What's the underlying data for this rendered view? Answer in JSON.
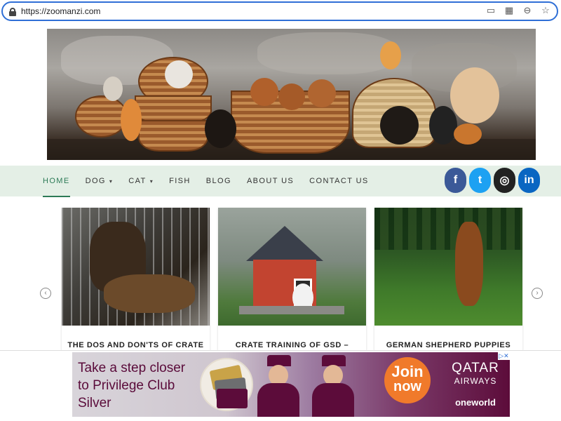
{
  "browser": {
    "url": "https://zoomanzi.com",
    "icons": [
      "cast-icon",
      "qr-code-icon",
      "zoom-icon",
      "bookmark-star-icon"
    ]
  },
  "nav": {
    "items": [
      {
        "label": "HOME",
        "active": true
      },
      {
        "label": "DOG",
        "dropdown": true
      },
      {
        "label": "CAT",
        "dropdown": true
      },
      {
        "label": "FISH"
      },
      {
        "label": "BLOG"
      },
      {
        "label": "ABOUT US"
      },
      {
        "label": "CONTACT US"
      }
    ],
    "social": [
      {
        "name": "facebook",
        "glyph": "f",
        "color": "#3b5998"
      },
      {
        "name": "twitter",
        "glyph": "t",
        "color": "#1da1f2"
      },
      {
        "name": "instagram",
        "glyph": "◎",
        "color": "#222222"
      },
      {
        "name": "linkedin",
        "glyph": "in",
        "color": "#0a66c2"
      }
    ]
  },
  "posts": [
    {
      "title": "THE DOS AND DON'TS OF CRATE"
    },
    {
      "title": "CRATE TRAINING OF GSD – ANSWER"
    },
    {
      "title": "GERMAN SHEPHERD PUPPIES POTTY"
    }
  ],
  "carousel": {
    "prev": "‹",
    "next": "›"
  },
  "ad": {
    "lines": [
      "Take a step closer",
      "to Privilege Club",
      "Silver"
    ],
    "join_1": "Join",
    "join_2": "now",
    "brand_1": "QATAR",
    "brand_2": "AIRWAYS",
    "alliance": "oneworld",
    "badge": "▷✕"
  }
}
